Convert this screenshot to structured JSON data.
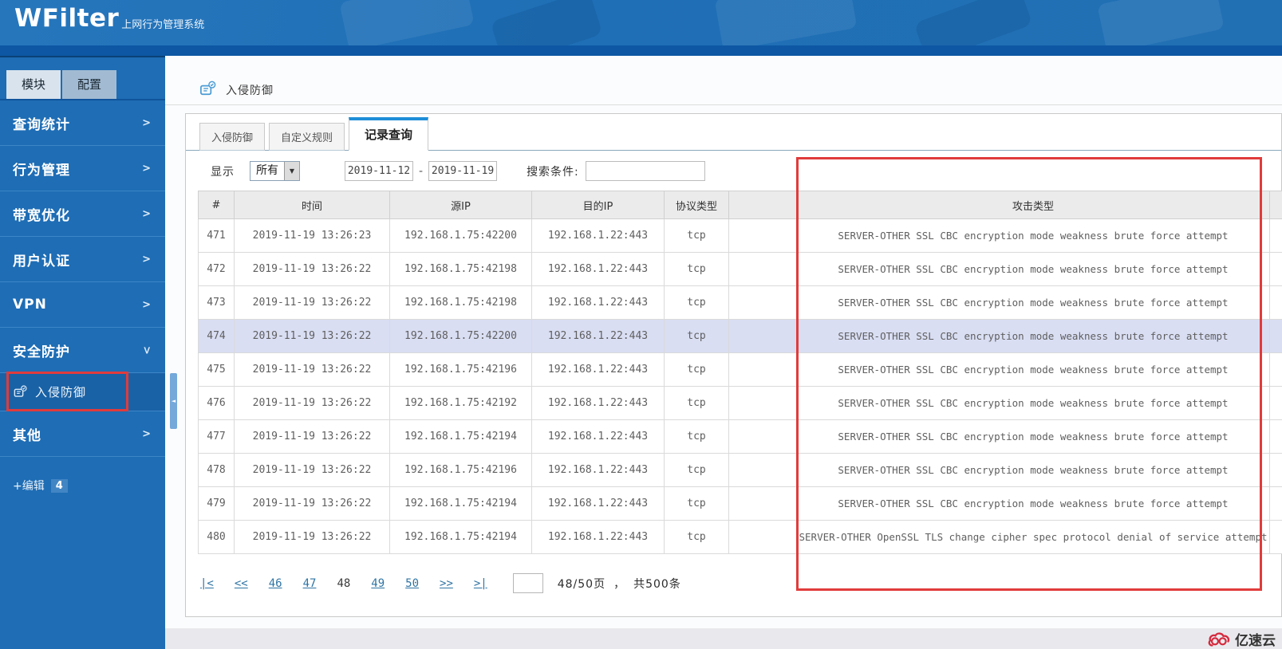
{
  "header": {
    "logo": "WFilter",
    "subtitle": "上网行为管理系统"
  },
  "sidebar": {
    "tabs": [
      {
        "label": "模块",
        "state": "active"
      },
      {
        "label": "配置",
        "state": "inactive"
      }
    ],
    "items": [
      {
        "label": "查询统计",
        "arrow": ">",
        "dir": "right"
      },
      {
        "label": "行为管理",
        "arrow": ">",
        "dir": "right"
      },
      {
        "label": "带宽优化",
        "arrow": ">",
        "dir": "right"
      },
      {
        "label": "用户认证",
        "arrow": ">",
        "dir": "right"
      },
      {
        "label": "VPN",
        "arrow": ">",
        "dir": "right"
      },
      {
        "label": "安全防护",
        "arrow": ">",
        "dir": "down"
      }
    ],
    "submenu": {
      "label": "入侵防御"
    },
    "other": {
      "label": "其他",
      "arrow": ">"
    },
    "edit_label": "+编辑",
    "edit_badge": "4"
  },
  "breadcrumb": {
    "title": "入侵防御"
  },
  "content_tabs": [
    {
      "label": "入侵防御",
      "state": ""
    },
    {
      "label": "自定义规则",
      "state": ""
    },
    {
      "label": "记录查询",
      "state": "active"
    }
  ],
  "filters": {
    "display_label": "显示",
    "display_value": "所有",
    "date_from": "2019-11-12",
    "date_separator": "-",
    "date_to": "2019-11-19",
    "search_label": "搜索条件:",
    "search_value": ""
  },
  "table": {
    "headers": [
      {
        "label": "#"
      },
      {
        "label": "时间"
      },
      {
        "label": "源IP"
      },
      {
        "label": "目的IP"
      },
      {
        "label": "协议类型"
      },
      {
        "label": ""
      },
      {
        "label": "攻击类型"
      },
      {
        "label": ""
      }
    ],
    "rows": [
      {
        "num": "471",
        "time": "2019-11-19 13:26:23",
        "src": "192.168.1.75:42200",
        "dst": "192.168.1.22:443",
        "proto": "tcp",
        "attack": "SERVER-OTHER SSL CBC encryption mode weakness brute force attempt",
        "state": ""
      },
      {
        "num": "472",
        "time": "2019-11-19 13:26:22",
        "src": "192.168.1.75:42198",
        "dst": "192.168.1.22:443",
        "proto": "tcp",
        "attack": "SERVER-OTHER SSL CBC encryption mode weakness brute force attempt",
        "state": ""
      },
      {
        "num": "473",
        "time": "2019-11-19 13:26:22",
        "src": "192.168.1.75:42198",
        "dst": "192.168.1.22:443",
        "proto": "tcp",
        "attack": "SERVER-OTHER SSL CBC encryption mode weakness brute force attempt",
        "state": ""
      },
      {
        "num": "474",
        "time": "2019-11-19 13:26:22",
        "src": "192.168.1.75:42200",
        "dst": "192.168.1.22:443",
        "proto": "tcp",
        "attack": "SERVER-OTHER SSL CBC encryption mode weakness brute force attempt",
        "state": "hl"
      },
      {
        "num": "475",
        "time": "2019-11-19 13:26:22",
        "src": "192.168.1.75:42196",
        "dst": "192.168.1.22:443",
        "proto": "tcp",
        "attack": "SERVER-OTHER SSL CBC encryption mode weakness brute force attempt",
        "state": ""
      },
      {
        "num": "476",
        "time": "2019-11-19 13:26:22",
        "src": "192.168.1.75:42192",
        "dst": "192.168.1.22:443",
        "proto": "tcp",
        "attack": "SERVER-OTHER SSL CBC encryption mode weakness brute force attempt",
        "state": ""
      },
      {
        "num": "477",
        "time": "2019-11-19 13:26:22",
        "src": "192.168.1.75:42194",
        "dst": "192.168.1.22:443",
        "proto": "tcp",
        "attack": "SERVER-OTHER SSL CBC encryption mode weakness brute force attempt",
        "state": ""
      },
      {
        "num": "478",
        "time": "2019-11-19 13:26:22",
        "src": "192.168.1.75:42196",
        "dst": "192.168.1.22:443",
        "proto": "tcp",
        "attack": "SERVER-OTHER SSL CBC encryption mode weakness brute force attempt",
        "state": ""
      },
      {
        "num": "479",
        "time": "2019-11-19 13:26:22",
        "src": "192.168.1.75:42194",
        "dst": "192.168.1.22:443",
        "proto": "tcp",
        "attack": "SERVER-OTHER SSL CBC encryption mode weakness brute force attempt",
        "state": ""
      },
      {
        "num": "480",
        "time": "2019-11-19 13:26:22",
        "src": "192.168.1.75:42194",
        "dst": "192.168.1.22:443",
        "proto": "tcp",
        "attack": "SERVER-OTHER OpenSSL TLS change cipher spec protocol denial of service attempt",
        "state": ""
      }
    ]
  },
  "pagination": {
    "items": [
      {
        "label": "|<",
        "type": "link"
      },
      {
        "label": "<<",
        "type": "link"
      },
      {
        "label": "46",
        "type": "link"
      },
      {
        "label": "47",
        "type": "link"
      },
      {
        "label": "48",
        "type": "current"
      },
      {
        "label": "49",
        "type": "link"
      },
      {
        "label": "50",
        "type": "link"
      },
      {
        "label": ">>",
        "type": "link"
      },
      {
        "label": ">|",
        "type": "link"
      }
    ],
    "jump_value": "",
    "page_info": "48/50页",
    "separator": "，",
    "total_info": "共500条"
  },
  "icons": {
    "dropdown_arrow": "▼",
    "collapse_arrow": "◄"
  },
  "footer": {
    "brand": "亿速云"
  },
  "colors": {
    "header_blue": "#2272b9",
    "sidebar_blue": "#1e6db5",
    "annotation_red": "#e13b3b",
    "highlight_row": "#d9def3",
    "tab_accent": "#1e8ed8",
    "link_blue": "#2f74a3",
    "badge_blue": "#4285c4"
  }
}
